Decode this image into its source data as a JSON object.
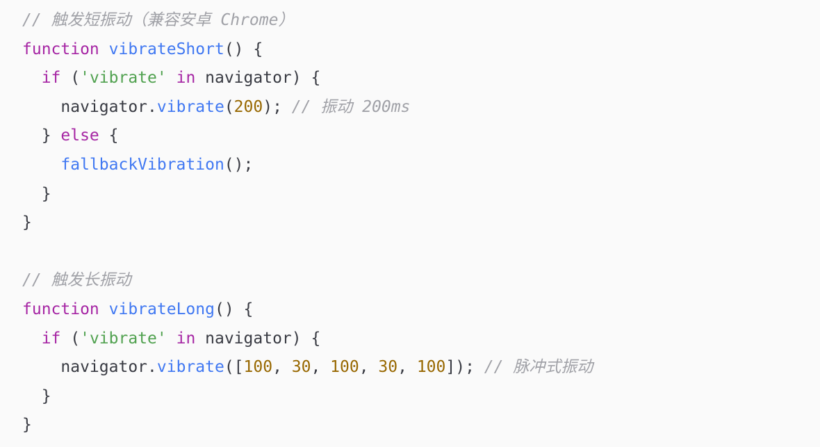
{
  "code_block": {
    "lines": [
      [
        {
          "t": "// 触发短振动（兼容安卓 Chrome）",
          "c": "comment"
        }
      ],
      [
        {
          "t": "function",
          "c": "kw"
        },
        {
          "t": " ",
          "c": "plain"
        },
        {
          "t": "vibrateShort",
          "c": "fn"
        },
        {
          "t": "() {",
          "c": "plain"
        }
      ],
      [
        {
          "t": "  ",
          "c": "plain"
        },
        {
          "t": "if",
          "c": "kw"
        },
        {
          "t": " (",
          "c": "plain"
        },
        {
          "t": "'vibrate'",
          "c": "str"
        },
        {
          "t": " ",
          "c": "plain"
        },
        {
          "t": "in",
          "c": "kw"
        },
        {
          "t": " navigator) {",
          "c": "plain"
        }
      ],
      [
        {
          "t": "    navigator.",
          "c": "plain"
        },
        {
          "t": "vibrate",
          "c": "fn"
        },
        {
          "t": "(",
          "c": "plain"
        },
        {
          "t": "200",
          "c": "num"
        },
        {
          "t": "); ",
          "c": "plain"
        },
        {
          "t": "// 振动 200ms",
          "c": "comment"
        }
      ],
      [
        {
          "t": "  } ",
          "c": "plain"
        },
        {
          "t": "else",
          "c": "kw"
        },
        {
          "t": " {",
          "c": "plain"
        }
      ],
      [
        {
          "t": "    ",
          "c": "plain"
        },
        {
          "t": "fallbackVibration",
          "c": "fn"
        },
        {
          "t": "();",
          "c": "plain"
        }
      ],
      [
        {
          "t": "  }",
          "c": "plain"
        }
      ],
      [
        {
          "t": "}",
          "c": "plain"
        }
      ],
      [],
      [
        {
          "t": "// 触发长振动",
          "c": "comment"
        }
      ],
      [
        {
          "t": "function",
          "c": "kw"
        },
        {
          "t": " ",
          "c": "plain"
        },
        {
          "t": "vibrateLong",
          "c": "fn"
        },
        {
          "t": "() {",
          "c": "plain"
        }
      ],
      [
        {
          "t": "  ",
          "c": "plain"
        },
        {
          "t": "if",
          "c": "kw"
        },
        {
          "t": " (",
          "c": "plain"
        },
        {
          "t": "'vibrate'",
          "c": "str"
        },
        {
          "t": " ",
          "c": "plain"
        },
        {
          "t": "in",
          "c": "kw"
        },
        {
          "t": " navigator) {",
          "c": "plain"
        }
      ],
      [
        {
          "t": "    navigator.",
          "c": "plain"
        },
        {
          "t": "vibrate",
          "c": "fn"
        },
        {
          "t": "([",
          "c": "plain"
        },
        {
          "t": "100",
          "c": "num"
        },
        {
          "t": ", ",
          "c": "plain"
        },
        {
          "t": "30",
          "c": "num"
        },
        {
          "t": ", ",
          "c": "plain"
        },
        {
          "t": "100",
          "c": "num"
        },
        {
          "t": ", ",
          "c": "plain"
        },
        {
          "t": "30",
          "c": "num"
        },
        {
          "t": ", ",
          "c": "plain"
        },
        {
          "t": "100",
          "c": "num"
        },
        {
          "t": "]); ",
          "c": "plain"
        },
        {
          "t": "// 脉冲式振动",
          "c": "comment"
        }
      ],
      [
        {
          "t": "  }",
          "c": "plain"
        }
      ],
      [
        {
          "t": "}",
          "c": "plain"
        }
      ]
    ]
  },
  "colors": {
    "background": "#fafafa",
    "text": "#383a42",
    "keyword": "#a626a4",
    "function": "#4078f2",
    "string": "#50a14f",
    "number": "#986801",
    "comment": "#a0a1a7"
  }
}
